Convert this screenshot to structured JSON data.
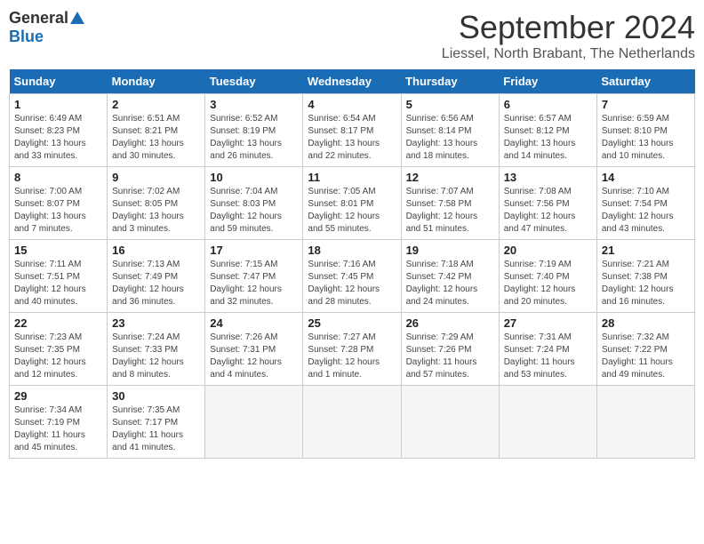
{
  "header": {
    "logo_general": "General",
    "logo_blue": "Blue",
    "month_title": "September 2024",
    "location": "Liessel, North Brabant, The Netherlands"
  },
  "days_of_week": [
    "Sunday",
    "Monday",
    "Tuesday",
    "Wednesday",
    "Thursday",
    "Friday",
    "Saturday"
  ],
  "weeks": [
    [
      {
        "day": 1,
        "info": "Sunrise: 6:49 AM\nSunset: 8:23 PM\nDaylight: 13 hours\nand 33 minutes."
      },
      {
        "day": 2,
        "info": "Sunrise: 6:51 AM\nSunset: 8:21 PM\nDaylight: 13 hours\nand 30 minutes."
      },
      {
        "day": 3,
        "info": "Sunrise: 6:52 AM\nSunset: 8:19 PM\nDaylight: 13 hours\nand 26 minutes."
      },
      {
        "day": 4,
        "info": "Sunrise: 6:54 AM\nSunset: 8:17 PM\nDaylight: 13 hours\nand 22 minutes."
      },
      {
        "day": 5,
        "info": "Sunrise: 6:56 AM\nSunset: 8:14 PM\nDaylight: 13 hours\nand 18 minutes."
      },
      {
        "day": 6,
        "info": "Sunrise: 6:57 AM\nSunset: 8:12 PM\nDaylight: 13 hours\nand 14 minutes."
      },
      {
        "day": 7,
        "info": "Sunrise: 6:59 AM\nSunset: 8:10 PM\nDaylight: 13 hours\nand 10 minutes."
      }
    ],
    [
      {
        "day": 8,
        "info": "Sunrise: 7:00 AM\nSunset: 8:07 PM\nDaylight: 13 hours\nand 7 minutes."
      },
      {
        "day": 9,
        "info": "Sunrise: 7:02 AM\nSunset: 8:05 PM\nDaylight: 13 hours\nand 3 minutes."
      },
      {
        "day": 10,
        "info": "Sunrise: 7:04 AM\nSunset: 8:03 PM\nDaylight: 12 hours\nand 59 minutes."
      },
      {
        "day": 11,
        "info": "Sunrise: 7:05 AM\nSunset: 8:01 PM\nDaylight: 12 hours\nand 55 minutes."
      },
      {
        "day": 12,
        "info": "Sunrise: 7:07 AM\nSunset: 7:58 PM\nDaylight: 12 hours\nand 51 minutes."
      },
      {
        "day": 13,
        "info": "Sunrise: 7:08 AM\nSunset: 7:56 PM\nDaylight: 12 hours\nand 47 minutes."
      },
      {
        "day": 14,
        "info": "Sunrise: 7:10 AM\nSunset: 7:54 PM\nDaylight: 12 hours\nand 43 minutes."
      }
    ],
    [
      {
        "day": 15,
        "info": "Sunrise: 7:11 AM\nSunset: 7:51 PM\nDaylight: 12 hours\nand 40 minutes."
      },
      {
        "day": 16,
        "info": "Sunrise: 7:13 AM\nSunset: 7:49 PM\nDaylight: 12 hours\nand 36 minutes."
      },
      {
        "day": 17,
        "info": "Sunrise: 7:15 AM\nSunset: 7:47 PM\nDaylight: 12 hours\nand 32 minutes."
      },
      {
        "day": 18,
        "info": "Sunrise: 7:16 AM\nSunset: 7:45 PM\nDaylight: 12 hours\nand 28 minutes."
      },
      {
        "day": 19,
        "info": "Sunrise: 7:18 AM\nSunset: 7:42 PM\nDaylight: 12 hours\nand 24 minutes."
      },
      {
        "day": 20,
        "info": "Sunrise: 7:19 AM\nSunset: 7:40 PM\nDaylight: 12 hours\nand 20 minutes."
      },
      {
        "day": 21,
        "info": "Sunrise: 7:21 AM\nSunset: 7:38 PM\nDaylight: 12 hours\nand 16 minutes."
      }
    ],
    [
      {
        "day": 22,
        "info": "Sunrise: 7:23 AM\nSunset: 7:35 PM\nDaylight: 12 hours\nand 12 minutes."
      },
      {
        "day": 23,
        "info": "Sunrise: 7:24 AM\nSunset: 7:33 PM\nDaylight: 12 hours\nand 8 minutes."
      },
      {
        "day": 24,
        "info": "Sunrise: 7:26 AM\nSunset: 7:31 PM\nDaylight: 12 hours\nand 4 minutes."
      },
      {
        "day": 25,
        "info": "Sunrise: 7:27 AM\nSunset: 7:28 PM\nDaylight: 12 hours\nand 1 minute."
      },
      {
        "day": 26,
        "info": "Sunrise: 7:29 AM\nSunset: 7:26 PM\nDaylight: 11 hours\nand 57 minutes."
      },
      {
        "day": 27,
        "info": "Sunrise: 7:31 AM\nSunset: 7:24 PM\nDaylight: 11 hours\nand 53 minutes."
      },
      {
        "day": 28,
        "info": "Sunrise: 7:32 AM\nSunset: 7:22 PM\nDaylight: 11 hours\nand 49 minutes."
      }
    ],
    [
      {
        "day": 29,
        "info": "Sunrise: 7:34 AM\nSunset: 7:19 PM\nDaylight: 11 hours\nand 45 minutes."
      },
      {
        "day": 30,
        "info": "Sunrise: 7:35 AM\nSunset: 7:17 PM\nDaylight: 11 hours\nand 41 minutes."
      },
      {
        "day": null,
        "info": ""
      },
      {
        "day": null,
        "info": ""
      },
      {
        "day": null,
        "info": ""
      },
      {
        "day": null,
        "info": ""
      },
      {
        "day": null,
        "info": ""
      }
    ]
  ]
}
